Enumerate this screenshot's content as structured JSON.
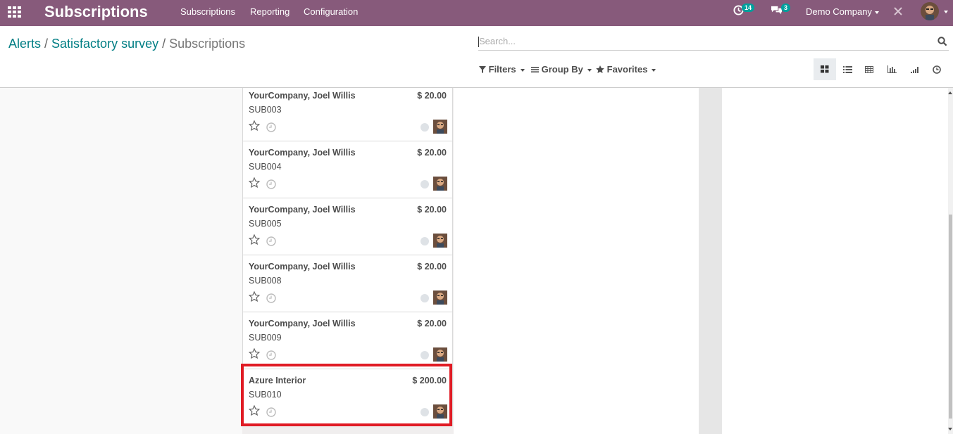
{
  "app": {
    "title": "Subscriptions",
    "menu": [
      "Subscriptions",
      "Reporting",
      "Configuration"
    ],
    "activity_count": "14",
    "message_count": "3",
    "company": "Demo Company"
  },
  "breadcrumb": {
    "items": [
      "Alerts",
      "Satisfactory survey"
    ],
    "current": "Subscriptions",
    "separator": "/"
  },
  "search": {
    "placeholder": "Search..."
  },
  "filters": {
    "filters_label": "Filters",
    "group_by_label": "Group By",
    "favorites_label": "Favorites"
  },
  "views": [
    "kanban-view",
    "list-view",
    "pivot-view",
    "graph-view",
    "cohort-view",
    "activity-view"
  ],
  "cards": [
    {
      "name": "YourCompany, Joel Willis",
      "amount": "$ 20.00",
      "ref": "SUB003"
    },
    {
      "name": "YourCompany, Joel Willis",
      "amount": "$ 20.00",
      "ref": "SUB004"
    },
    {
      "name": "YourCompany, Joel Willis",
      "amount": "$ 20.00",
      "ref": "SUB005"
    },
    {
      "name": "YourCompany, Joel Willis",
      "amount": "$ 20.00",
      "ref": "SUB008"
    },
    {
      "name": "YourCompany, Joel Willis",
      "amount": "$ 20.00",
      "ref": "SUB009"
    },
    {
      "name": "Azure Interior",
      "amount": "$ 200.00",
      "ref": "SUB010"
    }
  ],
  "colors": {
    "navbar": "#875a7b",
    "link": "#017e84",
    "highlight": "#e01b24",
    "badge": "#00a09d"
  }
}
